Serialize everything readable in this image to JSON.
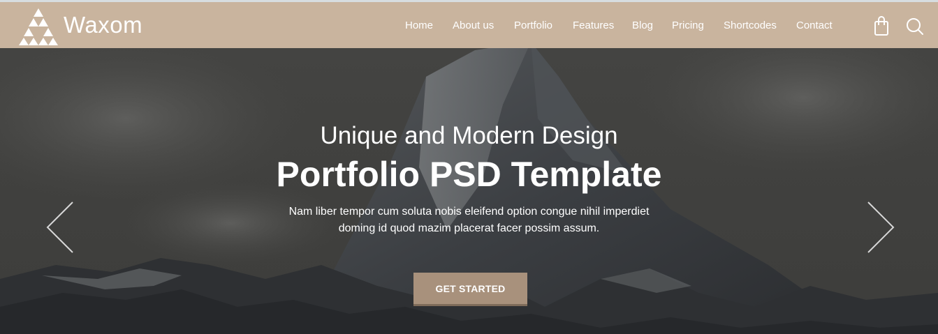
{
  "brand": {
    "name": "Waxom",
    "logo_icon": "triangle-logo-icon"
  },
  "nav": {
    "items": [
      {
        "label": "Home"
      },
      {
        "label": "About us"
      },
      {
        "label": "Portfolio"
      },
      {
        "label": "Features"
      },
      {
        "label": "Blog"
      },
      {
        "label": "Pricing"
      },
      {
        "label": "Shortcodes"
      },
      {
        "label": "Contact"
      }
    ],
    "cart_icon": "shopping-bag-icon",
    "search_icon": "search-icon"
  },
  "hero": {
    "subtitle": "Unique and Modern Design",
    "title": "Portfolio PSD Template",
    "text_line1": "Nam liber tempor cum soluta nobis eleifend option congue nihil imperdiet",
    "text_line2": "doming id quod mazim placerat facer possim assum.",
    "button_label": "GET STARTED",
    "prev_icon": "chevron-left-icon",
    "next_icon": "chevron-right-icon"
  },
  "colors": {
    "navbar": "#c9b49e",
    "button": "#a8917c",
    "text": "#ffffff"
  }
}
